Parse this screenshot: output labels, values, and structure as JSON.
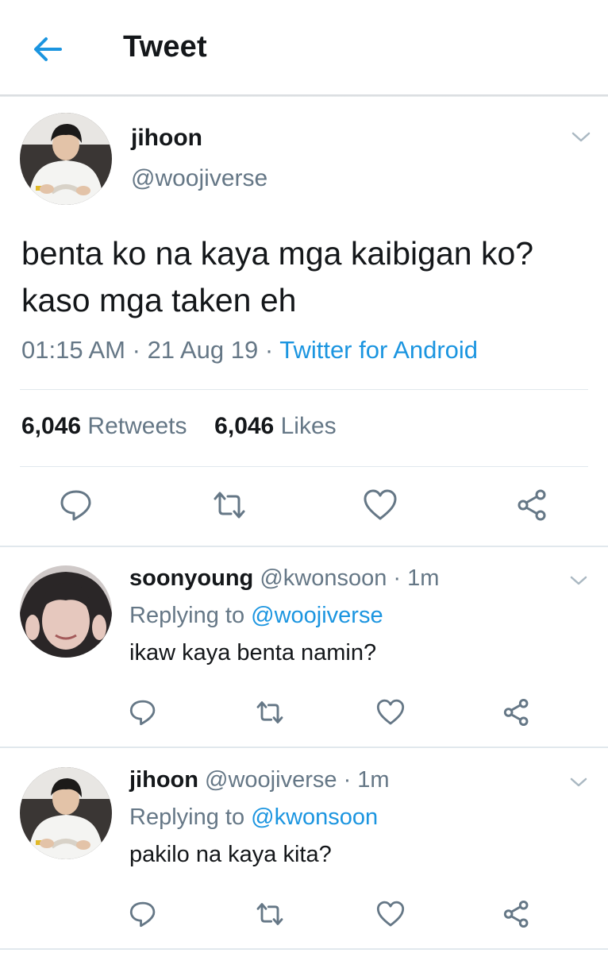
{
  "header": {
    "title": "Tweet"
  },
  "tweet": {
    "display_name": "jihoon",
    "handle": "@woojiverse",
    "text": "benta ko na kaya mga kaibigan ko? kaso mga taken eh",
    "time": "01:15 AM",
    "date": "21 Aug 19",
    "dot": "·",
    "source": "Twitter for Android",
    "retweet_count": "6,046",
    "retweets_label": "Retweets",
    "like_count": "6,046",
    "likes_label": "Likes"
  },
  "replies": [
    {
      "display_name": "soonyoung",
      "handle": "@kwonsoon",
      "dot": "·",
      "time": "1m",
      "replying_prefix": "Replying to",
      "replying_to": "@woojiverse",
      "text": "ikaw kaya benta namin?"
    },
    {
      "display_name": "jihoon",
      "handle": "@woojiverse",
      "dot": "·",
      "time": "1m",
      "replying_prefix": "Replying to",
      "replying_to": "@kwonsoon",
      "text": "pakilo na kaya kita?"
    }
  ],
  "icons": {
    "back": "back-arrow-icon",
    "chevron": "chevron-down-icon",
    "reply": "reply-icon",
    "retweet": "retweet-icon",
    "like": "heart-icon",
    "share": "share-icon"
  },
  "colors": {
    "accent": "#1b95e0",
    "secondary_text": "#657786",
    "primary_text": "#14171a",
    "divider": "#e1e8ed"
  }
}
